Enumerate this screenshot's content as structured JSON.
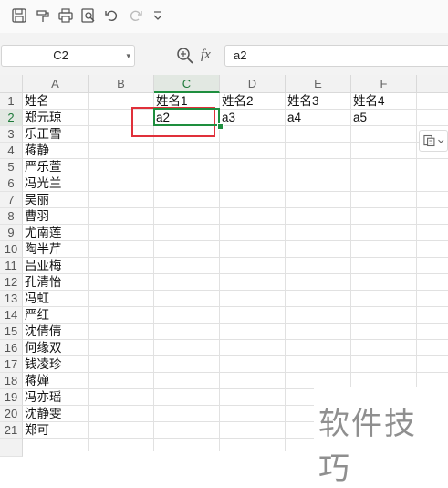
{
  "toolbar": {
    "icons": [
      "save-icon",
      "format-painter-icon",
      "print-icon",
      "print-preview-icon",
      "undo-icon",
      "redo-icon",
      "customize-toolbar-icon"
    ]
  },
  "formula_bar": {
    "name_box": "C2",
    "fx_label": "fx",
    "formula": "a2"
  },
  "sheet": {
    "columns": [
      "A",
      "B",
      "C",
      "D",
      "E",
      "F"
    ],
    "active_column": "C",
    "active_row": "2",
    "rows": [
      {
        "num": "1",
        "A": "姓名",
        "C": "姓名1",
        "D": "姓名2",
        "E": "姓名3",
        "F": "姓名4"
      },
      {
        "num": "2",
        "A": "郑元琼",
        "C": "a2",
        "D": "a3",
        "E": "a4",
        "F": "a5"
      },
      {
        "num": "3",
        "A": "乐正雪"
      },
      {
        "num": "4",
        "A": "蒋静"
      },
      {
        "num": "5",
        "A": "严乐萱"
      },
      {
        "num": "6",
        "A": "冯光兰"
      },
      {
        "num": "7",
        "A": "吴丽"
      },
      {
        "num": "8",
        "A": "曹羽"
      },
      {
        "num": "9",
        "A": "尤南莲"
      },
      {
        "num": "10",
        "A": "陶半芹"
      },
      {
        "num": "11",
        "A": "吕亚梅"
      },
      {
        "num": "12",
        "A": "孔清怡"
      },
      {
        "num": "13",
        "A": "冯虹"
      },
      {
        "num": "14",
        "A": "严红"
      },
      {
        "num": "15",
        "A": "沈倩倩"
      },
      {
        "num": "16",
        "A": "何缘双"
      },
      {
        "num": "17",
        "A": "钱凌珍"
      },
      {
        "num": "18",
        "A": "蒋婵"
      },
      {
        "num": "19",
        "A": "冯亦瑶"
      },
      {
        "num": "20",
        "A": "沈静雯"
      },
      {
        "num": "21",
        "A": "郑可"
      }
    ]
  },
  "watermark": "软件技巧",
  "colors": {
    "selection": "#1e8e3e",
    "highlight": "#e0303a"
  }
}
